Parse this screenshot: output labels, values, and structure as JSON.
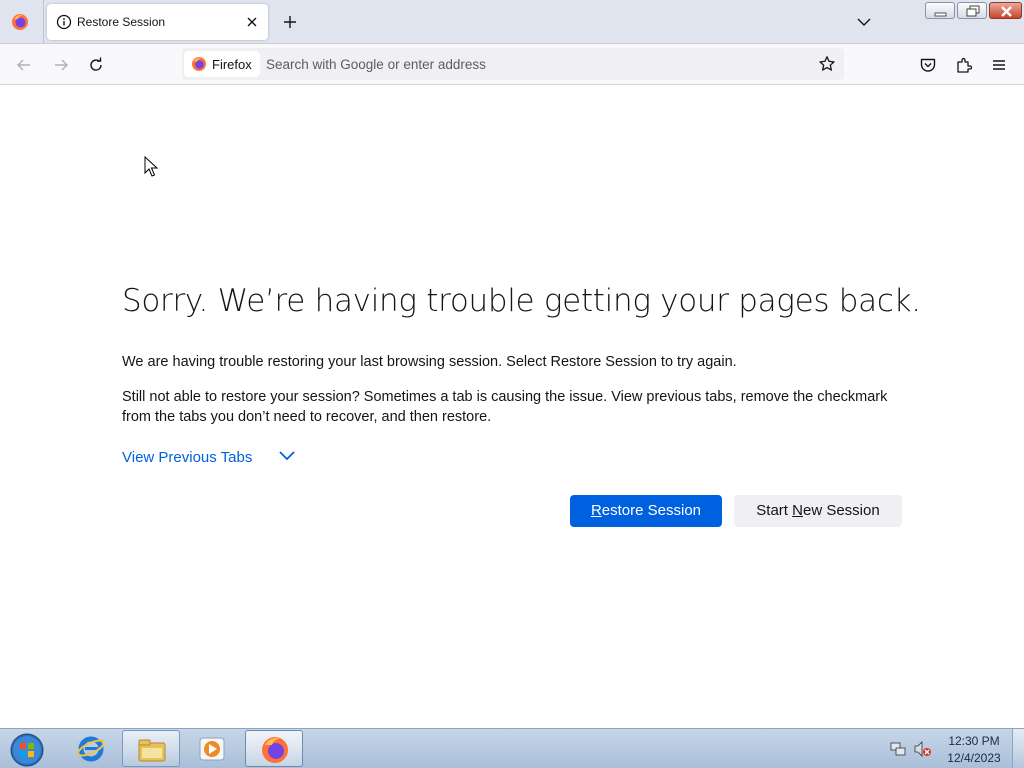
{
  "tabstrip": {
    "active_tab_title": "Restore Session",
    "app_icon": "firefox-icon",
    "new_tab_icon": "plus-icon",
    "tab_list_icon": "chevron-down-icon"
  },
  "window_controls": {
    "minimize": "minimize-icon",
    "maximize": "restore-down-icon",
    "close": "close-icon"
  },
  "navbar": {
    "identity_label": "Firefox",
    "url_placeholder": "Search with Google or enter address",
    "icons": [
      "back-arrow-icon",
      "forward-arrow-icon",
      "reload-icon",
      "star-icon",
      "pocket-icon",
      "extensions-icon",
      "hamburger-menu-icon"
    ]
  },
  "content": {
    "title": "Sorry. We’re having trouble getting your pages back.",
    "paragraph1": "We are having trouble restoring your last browsing session. Select Restore Session to try again.",
    "paragraph2": "Still not able to restore your session? Sometimes a tab is causing the issue. View previous tabs, remove the checkmark from the tabs you don’t need to recover, and then restore.",
    "view_previous_tabs": "View Previous Tabs",
    "restore_button": {
      "accesskey": "R",
      "rest": "estore Session"
    },
    "new_session_button": {
      "before": "Start ",
      "accesskey": "N",
      "after": "ew Session"
    }
  },
  "colors": {
    "accent": "#0061e0",
    "text": "#15141a",
    "secondary_button": "#f0f0f4"
  },
  "taskbar": {
    "pinned": [
      "windows-start-orb-icon",
      "internet-explorer-icon",
      "windows-explorer-icon",
      "media-player-icon",
      "firefox-icon"
    ],
    "clock_time": "12:30 PM",
    "clock_date": "12/4/2023"
  }
}
